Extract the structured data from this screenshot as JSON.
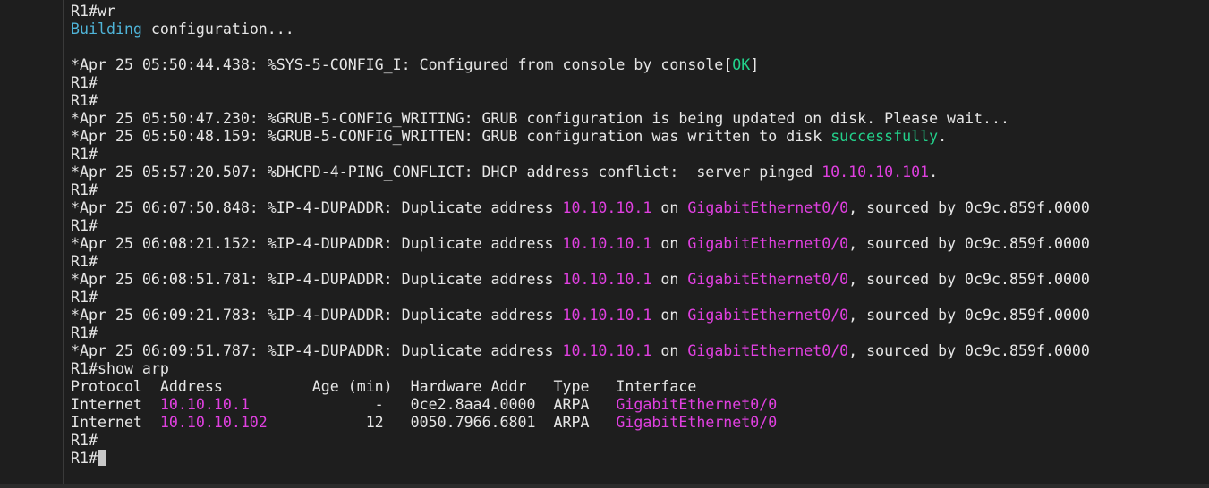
{
  "terminal": {
    "lines": [
      [
        {
          "t": "R1#wr"
        }
      ],
      [
        {
          "t": "Building",
          "c": "cyan"
        },
        {
          "t": " configuration..."
        }
      ],
      [],
      [
        {
          "t": "*Apr 25 05:50:44.438: %SYS-5-CONFIG_I: Configured from console by console["
        },
        {
          "t": "OK",
          "c": "green"
        },
        {
          "t": "]"
        }
      ],
      [
        {
          "t": "R1#"
        }
      ],
      [
        {
          "t": "R1#"
        }
      ],
      [
        {
          "t": "*Apr 25 05:50:47.230: %GRUB-5-CONFIG_WRITING: GRUB configuration is being updated on disk. Please wait..."
        }
      ],
      [
        {
          "t": "*Apr 25 05:50:48.159: %GRUB-5-CONFIG_WRITTEN: GRUB configuration was written to disk "
        },
        {
          "t": "successfully",
          "c": "green"
        },
        {
          "t": "."
        }
      ],
      [
        {
          "t": "R1#"
        }
      ],
      [
        {
          "t": "*Apr 25 05:57:20.507: %DHCPD-4-PING_CONFLICT: DHCP address conflict:  server pinged "
        },
        {
          "t": "10.10.10.101",
          "c": "magenta"
        },
        {
          "t": "."
        }
      ],
      [
        {
          "t": "R1#"
        }
      ],
      [
        {
          "t": "*Apr 25 06:07:50.848: %IP-4-DUPADDR: Duplicate address "
        },
        {
          "t": "10.10.10.1",
          "c": "magenta"
        },
        {
          "t": " on "
        },
        {
          "t": "GigabitEthernet0/0",
          "c": "magenta"
        },
        {
          "t": ", sourced by 0c9c.859f.0000"
        }
      ],
      [
        {
          "t": "R1#"
        }
      ],
      [
        {
          "t": "*Apr 25 06:08:21.152: %IP-4-DUPADDR: Duplicate address "
        },
        {
          "t": "10.10.10.1",
          "c": "magenta"
        },
        {
          "t": " on "
        },
        {
          "t": "GigabitEthernet0/0",
          "c": "magenta"
        },
        {
          "t": ", sourced by 0c9c.859f.0000"
        }
      ],
      [
        {
          "t": "R1#"
        }
      ],
      [
        {
          "t": "*Apr 25 06:08:51.781: %IP-4-DUPADDR: Duplicate address "
        },
        {
          "t": "10.10.10.1",
          "c": "magenta"
        },
        {
          "t": " on "
        },
        {
          "t": "GigabitEthernet0/0",
          "c": "magenta"
        },
        {
          "t": ", sourced by 0c9c.859f.0000"
        }
      ],
      [
        {
          "t": "R1#"
        }
      ],
      [
        {
          "t": "*Apr 25 06:09:21.783: %IP-4-DUPADDR: Duplicate address "
        },
        {
          "t": "10.10.10.1",
          "c": "magenta"
        },
        {
          "t": " on "
        },
        {
          "t": "GigabitEthernet0/0",
          "c": "magenta"
        },
        {
          "t": ", sourced by 0c9c.859f.0000"
        }
      ],
      [
        {
          "t": "R1#"
        }
      ],
      [
        {
          "t": "*Apr 25 06:09:51.787: %IP-4-DUPADDR: Duplicate address "
        },
        {
          "t": "10.10.10.1",
          "c": "magenta"
        },
        {
          "t": " on "
        },
        {
          "t": "GigabitEthernet0/0",
          "c": "magenta"
        },
        {
          "t": ", sourced by 0c9c.859f.0000"
        }
      ],
      [
        {
          "t": "R1#show arp"
        }
      ],
      [
        {
          "t": "Protocol  Address          Age (min)  Hardware Addr   Type   Interface"
        }
      ],
      [
        {
          "t": "Internet  "
        },
        {
          "t": "10.10.10.1",
          "c": "magenta"
        },
        {
          "t": "              -   0ce2.8aa4.0000  ARPA   "
        },
        {
          "t": "GigabitEthernet0/0",
          "c": "magenta"
        }
      ],
      [
        {
          "t": "Internet  "
        },
        {
          "t": "10.10.10.102",
          "c": "magenta"
        },
        {
          "t": "           12   0050.7966.6801  ARPA   "
        },
        {
          "t": "GigabitEthernet0/0",
          "c": "magenta"
        }
      ],
      [
        {
          "t": "R1#"
        }
      ],
      [
        {
          "t": "R1#"
        }
      ]
    ],
    "cursor_after_last_line": true
  },
  "colors": {
    "background": "#1e1e1e",
    "text": "#e6e6e6",
    "cyan": "#4fb4d8",
    "green": "#23d18b",
    "magenta": "#e040e0"
  }
}
